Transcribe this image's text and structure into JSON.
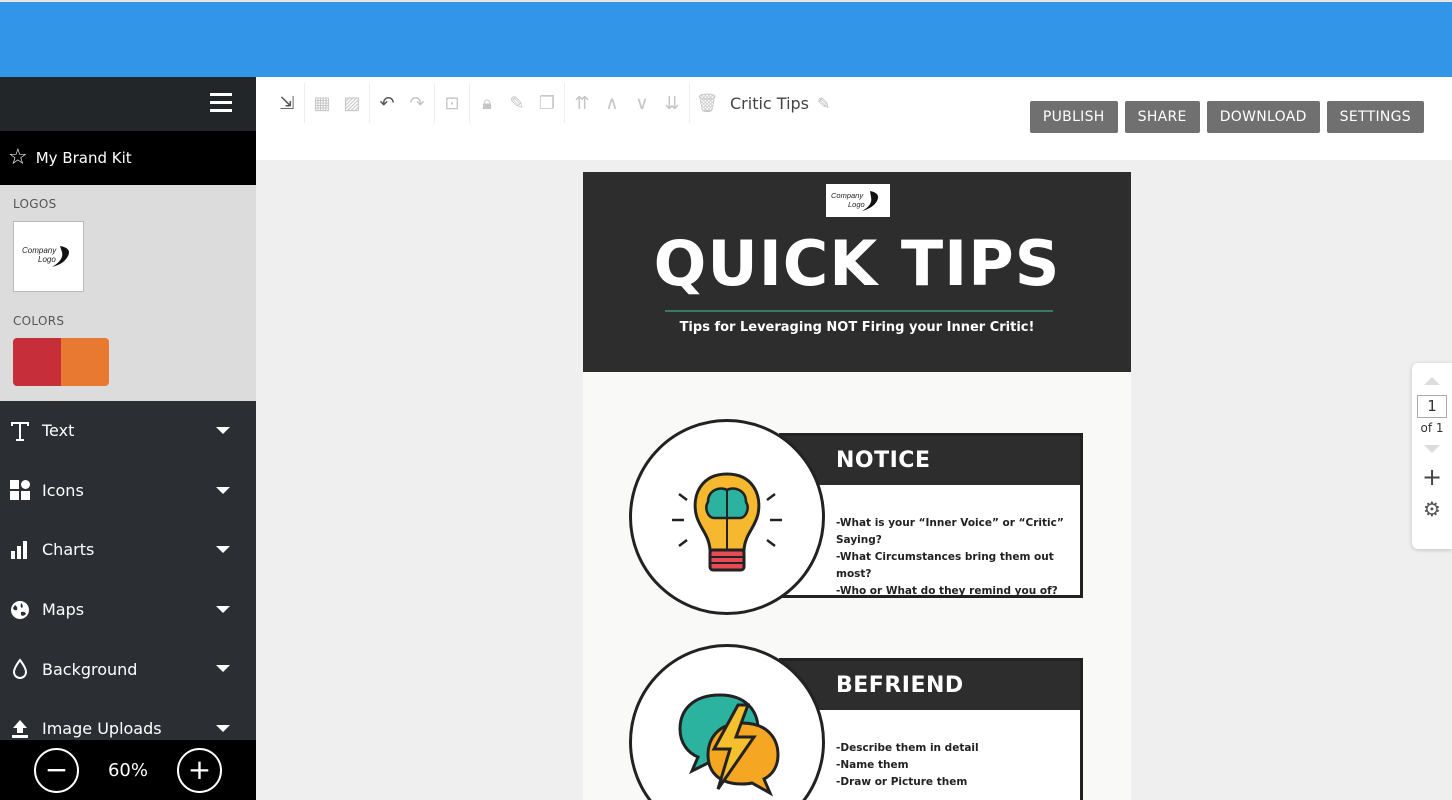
{
  "sidebar": {
    "brand_kit_label": "My Brand Kit",
    "logos_label": "LOGOS",
    "colors_label": "COLORS",
    "logo_text": "Company Logo",
    "brand_colors": [
      "#c62f3a",
      "#e87930"
    ],
    "items": [
      {
        "label": "Text",
        "icon": "text-icon"
      },
      {
        "label": "Icons",
        "icon": "shapes-icon"
      },
      {
        "label": "Charts",
        "icon": "bar-chart-icon"
      },
      {
        "label": "Maps",
        "icon": "globe-icon"
      },
      {
        "label": "Background",
        "icon": "droplet-icon"
      },
      {
        "label": "Image Uploads",
        "icon": "upload-icon"
      }
    ],
    "zoom": "60%"
  },
  "toolbar": {
    "doc_name": "Critic Tips",
    "buttons": {
      "publish": "PUBLISH",
      "share": "SHARE",
      "download": "DOWNLOAD",
      "settings": "SETTINGS"
    }
  },
  "document": {
    "logo_text": "Company Logo",
    "title": "QUICK TIPS",
    "subtitle": "Tips for Leveraging NOT Firing your Inner Critic!",
    "sections": [
      {
        "heading": "NOTICE",
        "lines": [
          "-What is your “Inner Voice” or “Critic” Saying?",
          "-What Circumstances bring them out most?",
          "-Who or What do they remind you of?"
        ]
      },
      {
        "heading": "BEFRIEND",
        "lines": [
          "-Describe them in detail",
          "-Name them",
          "-Draw or Picture them"
        ]
      }
    ]
  },
  "pager": {
    "page": "1",
    "of": "of 1"
  }
}
